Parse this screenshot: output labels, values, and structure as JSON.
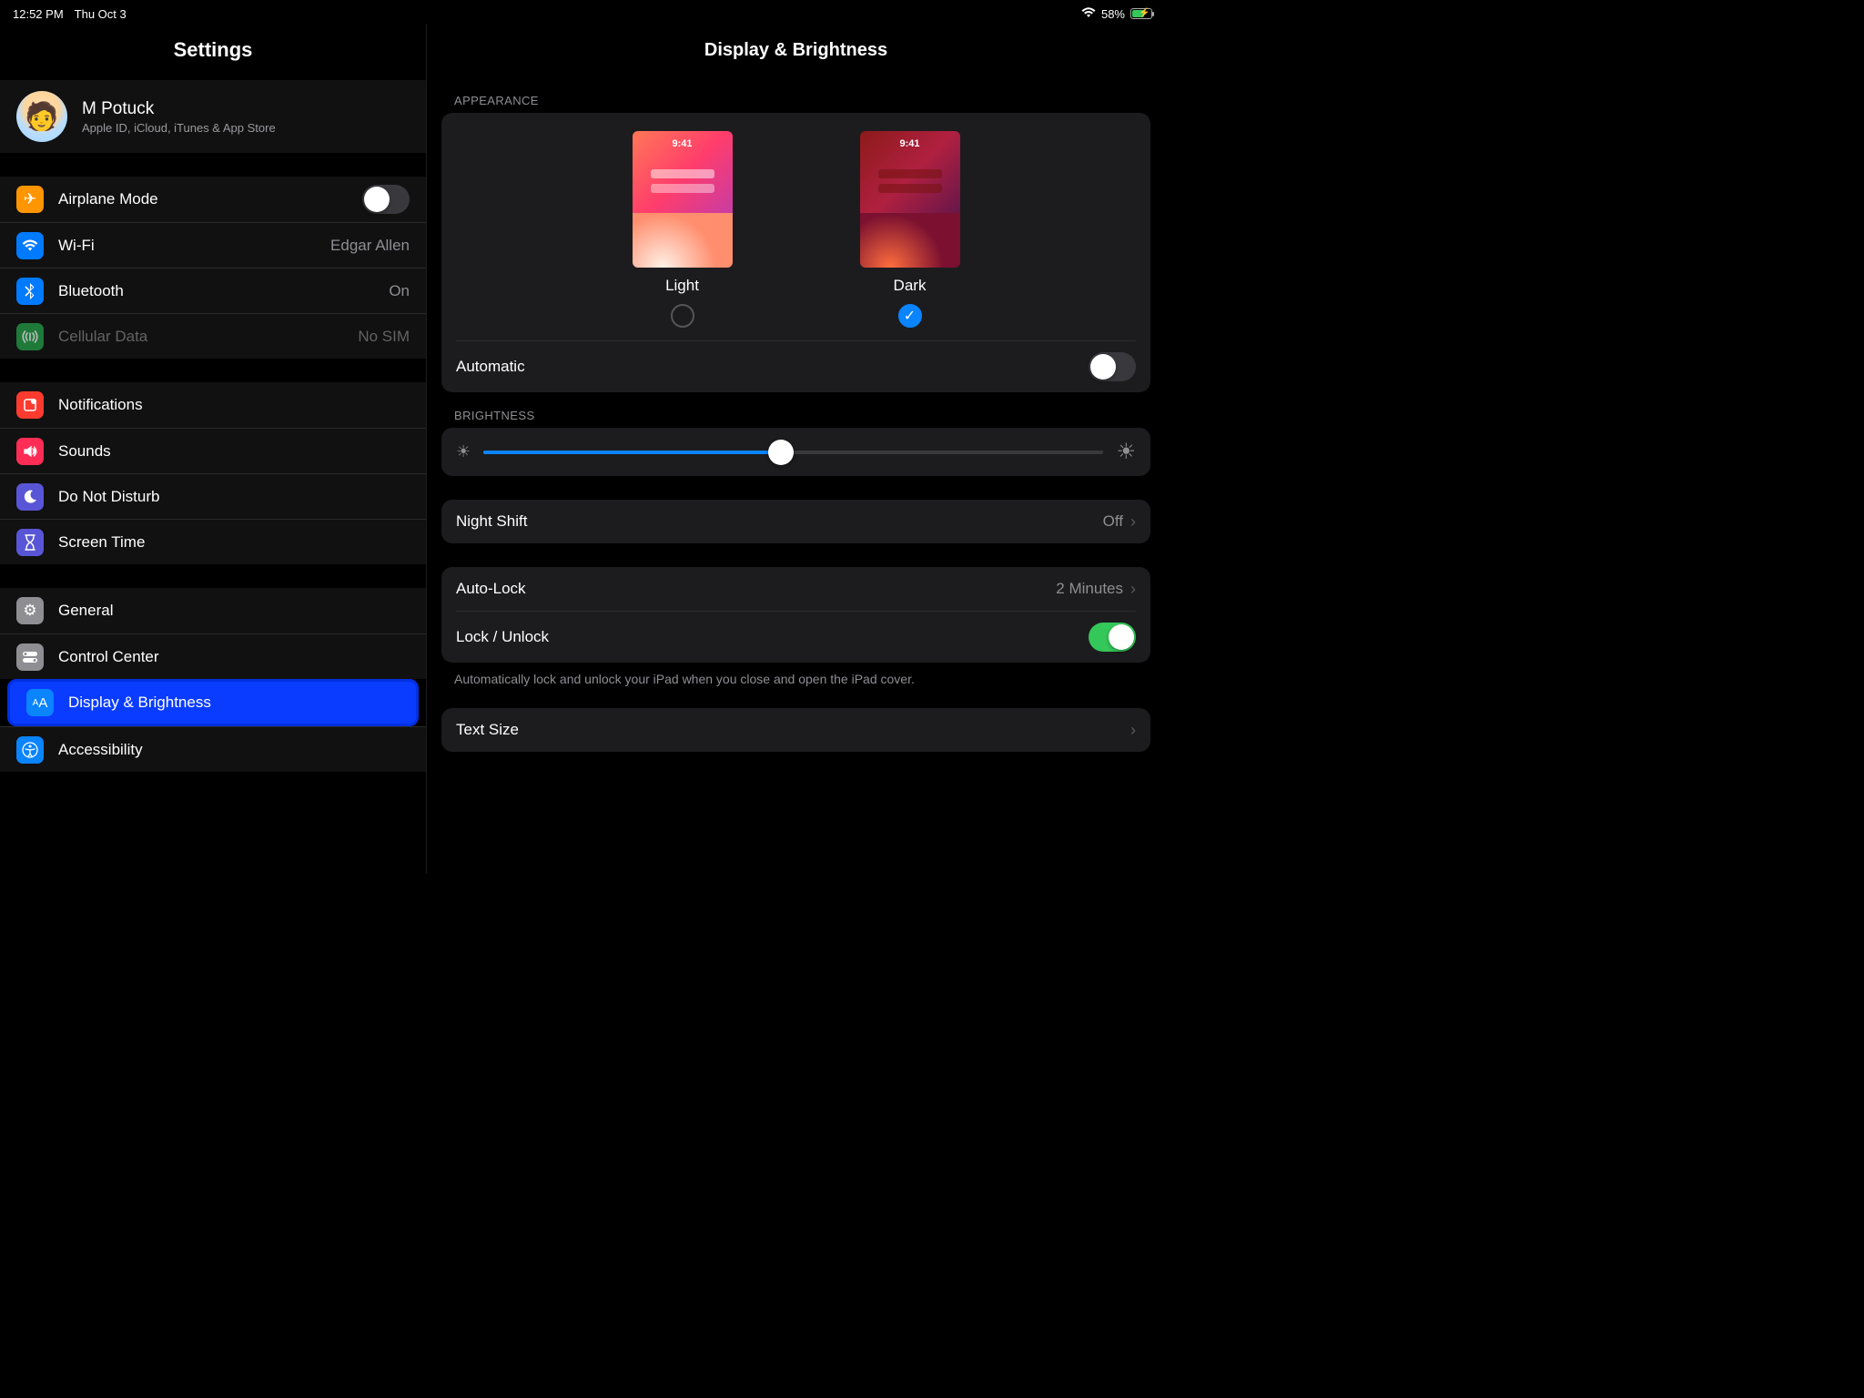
{
  "status": {
    "time": "12:52 PM",
    "date": "Thu Oct 3",
    "battery": "58%"
  },
  "sidebar": {
    "title": "Settings",
    "profile": {
      "name": "M Potuck",
      "sub": "Apple ID, iCloud, iTunes & App Store"
    },
    "g1": {
      "airplane": "Airplane Mode",
      "wifi": "Wi-Fi",
      "wifiValue": "Edgar Allen",
      "bluetooth": "Bluetooth",
      "btValue": "On",
      "cellular": "Cellular Data",
      "cellValue": "No SIM"
    },
    "g2": {
      "notifications": "Notifications",
      "sounds": "Sounds",
      "dnd": "Do Not Disturb",
      "screentime": "Screen Time"
    },
    "g3": {
      "general": "General",
      "controlcenter": "Control Center",
      "display": "Display & Brightness",
      "accessibility": "Accessibility"
    }
  },
  "detail": {
    "title": "Display & Brightness",
    "sections": {
      "appearance": "APPEARANCE",
      "brightness": "BRIGHTNESS"
    },
    "appearance": {
      "light": "Light",
      "dark": "Dark",
      "previewTime": "9:41",
      "automatic": "Automatic"
    },
    "nightshift": {
      "label": "Night Shift",
      "value": "Off"
    },
    "autolock": {
      "label": "Auto-Lock",
      "value": "2 Minutes"
    },
    "lockunlock": {
      "label": "Lock / Unlock"
    },
    "lockNote": "Automatically lock and unlock your iPad when you close and open the iPad cover.",
    "textsize": "Text Size"
  }
}
